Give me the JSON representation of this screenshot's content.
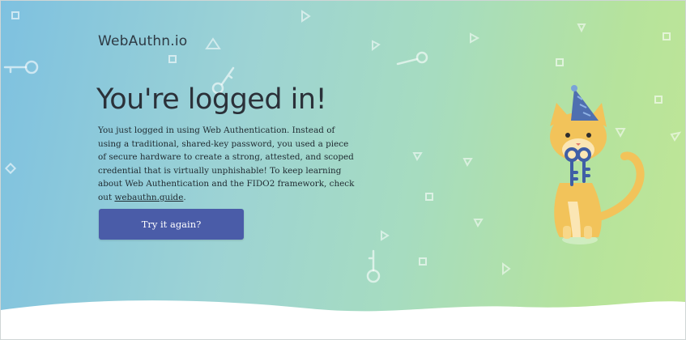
{
  "brand": {
    "name": "WebAuthn.io"
  },
  "main": {
    "headline": "You're logged in!",
    "body_before_link": "You just logged in using Web Authentication. Instead of using a traditional, shared-key password, you used a piece of secure hardware to create a strong, attested, and scoped credential that is virtually unphishable! To keep learning about Web Authentication and the FIDO2 framework, check out ",
    "link_text": "webauthn.guide",
    "body_after_link": ".",
    "cta_label": "Try it again?"
  },
  "icons": {
    "mascot": "cat-with-keys-icon",
    "background": [
      "key-icon",
      "triangle-icon",
      "square-icon"
    ]
  },
  "colors": {
    "button": "#4a5ca8",
    "gradient_left": "#7ec1e0",
    "gradient_right": "#c0e696",
    "cat_body": "#f2c35a",
    "party_hat": "#4f6fb0",
    "keys": "#3f5ea6"
  }
}
